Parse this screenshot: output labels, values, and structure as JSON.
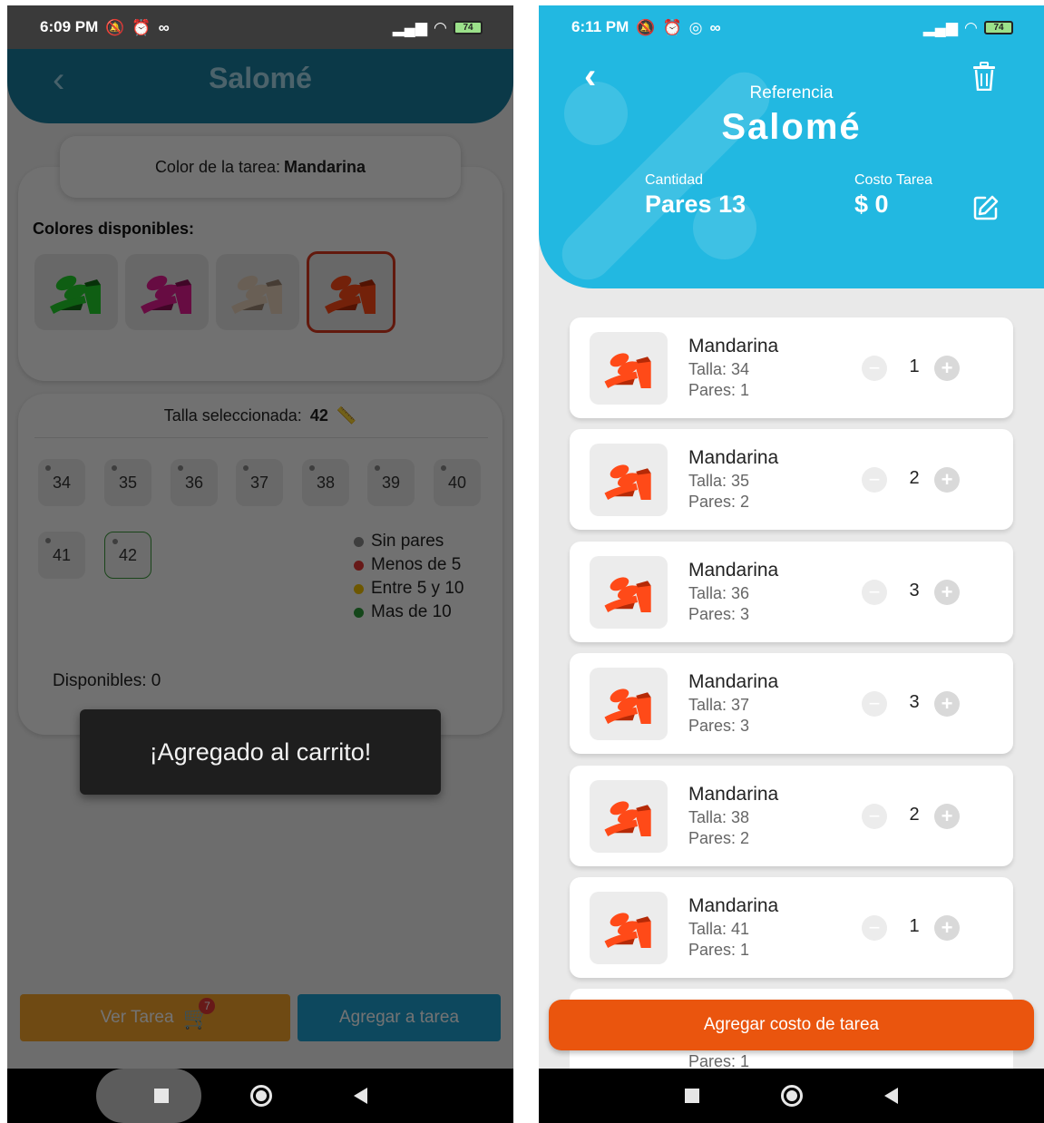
{
  "left": {
    "status": {
      "time": "6:09 PM",
      "battery": "74"
    },
    "header": {
      "title": "Salomé",
      "back_glyph": "‹"
    },
    "task_color": {
      "label": "Color de la tarea:",
      "value": "Mandarina"
    },
    "colors_label": "Colores disponibles:",
    "swatches": [
      {
        "color": "#22d12a",
        "accent": "#116e14",
        "selected": false
      },
      {
        "color": "#e51c92",
        "accent": "#8e0f58",
        "selected": false
      },
      {
        "color": "#e8d3bd",
        "accent": "#9b8673",
        "selected": false
      },
      {
        "color": "#ff4a18",
        "accent": "#b52a07",
        "selected": true
      }
    ],
    "size_selected": {
      "label": "Talla seleccionada:",
      "value": "42"
    },
    "sizes": [
      "34",
      "35",
      "36",
      "37",
      "38",
      "39",
      "40",
      "41",
      "42"
    ],
    "selected_size": "42",
    "legend": [
      {
        "label": "Sin pares",
        "color": "#8a8a8a"
      },
      {
        "label": "Menos de 5",
        "color": "#e53935"
      },
      {
        "label": "Entre 5 y 10",
        "color": "#f2c200"
      },
      {
        "label": "Mas de 10",
        "color": "#2e9c3a"
      }
    ],
    "available": {
      "label": "Disponibles:",
      "value": "0"
    },
    "toast": "¡Agregado al carrito!",
    "btn_view_task": "Ver Tarea",
    "cart_badge": "7",
    "btn_add_task": "Agregar a tarea"
  },
  "right": {
    "status": {
      "time": "6:11 PM",
      "battery": "74"
    },
    "header": {
      "reference_label": "Referencia",
      "title": "Salomé",
      "qty_label": "Cantidad",
      "qty_value": "Pares 13",
      "cost_label": "Costo Tarea",
      "cost_value": "$ 0"
    },
    "items": [
      {
        "name": "Mandarina",
        "talla": "Talla: 34",
        "pares": "Pares: 1",
        "count": "1"
      },
      {
        "name": "Mandarina",
        "talla": "Talla: 35",
        "pares": "Pares: 2",
        "count": "2"
      },
      {
        "name": "Mandarina",
        "talla": "Talla: 36",
        "pares": "Pares: 3",
        "count": "3"
      },
      {
        "name": "Mandarina",
        "talla": "Talla: 37",
        "pares": "Pares: 3",
        "count": "3"
      },
      {
        "name": "Mandarina",
        "talla": "Talla: 38",
        "pares": "Pares: 2",
        "count": "2"
      },
      {
        "name": "Mandarina",
        "talla": "Talla: 41",
        "pares": "Pares: 1",
        "count": "1"
      }
    ],
    "partial_item": {
      "pares": "Pares: 1"
    },
    "cta": "Agregar costo de tarea"
  }
}
